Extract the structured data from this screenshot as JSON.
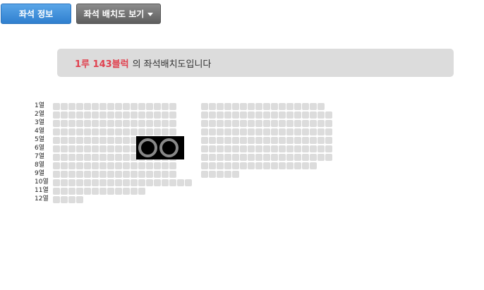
{
  "buttons": {
    "seat_info": "좌석 정보",
    "seat_map": "좌석 배치도 보기"
  },
  "banner": {
    "highlight": "1루 143블럭",
    "text": "의 좌석배치도입니다"
  },
  "rows": [
    "1열",
    "2열",
    "3열",
    "4열",
    "5열",
    "6열",
    "7열",
    "8열",
    "9열",
    "10열",
    "11열",
    "12열"
  ]
}
